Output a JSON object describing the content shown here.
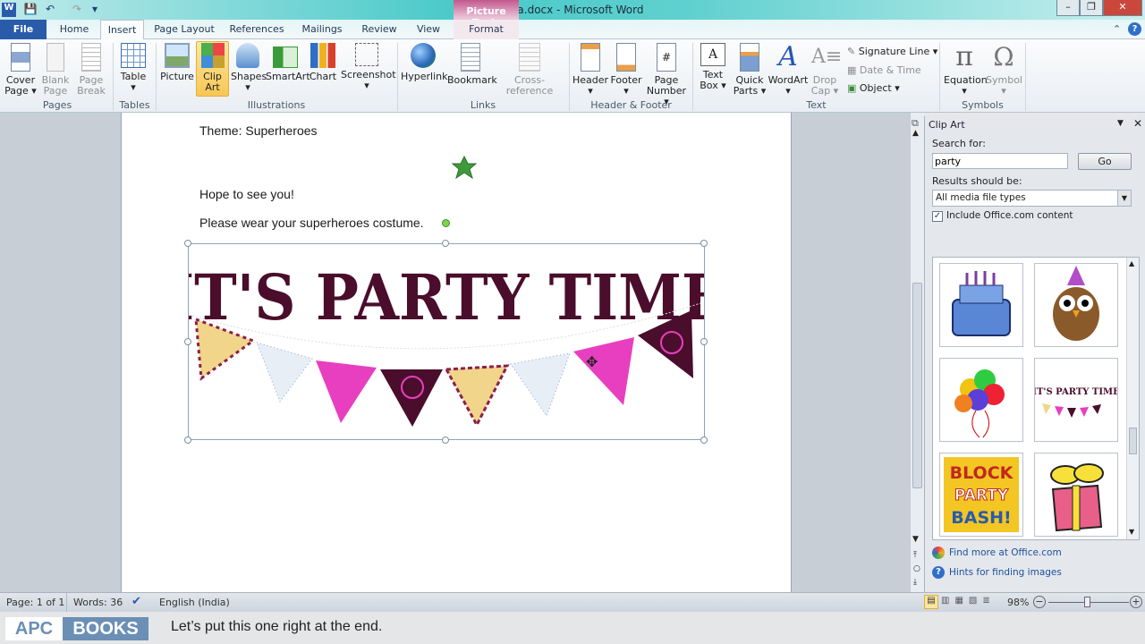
{
  "window": {
    "title": "Tina.docx - Microsoft Word",
    "context_tab_group": "Picture Tools"
  },
  "quick_access": [
    "word-app-icon",
    "save-icon",
    "undo-icon",
    "redo-icon",
    "customize-icon"
  ],
  "tabs": [
    {
      "label": "File"
    },
    {
      "label": "Home"
    },
    {
      "label": "Insert",
      "active": true
    },
    {
      "label": "Page Layout"
    },
    {
      "label": "References"
    },
    {
      "label": "Mailings"
    },
    {
      "label": "Review"
    },
    {
      "label": "View"
    },
    {
      "label": "Format"
    }
  ],
  "ribbon": {
    "groups": [
      "Pages",
      "Tables",
      "Illustrations",
      "Links",
      "Header & Footer",
      "Text",
      "Symbols"
    ],
    "buttons": [
      {
        "l1": "Cover",
        "l2": "Page ▾"
      },
      {
        "l1": "Blank",
        "l2": "Page"
      },
      {
        "l1": "Page",
        "l2": "Break"
      },
      {
        "l1": "Table",
        "l2": "▾"
      },
      {
        "l1": "Picture",
        "l2": ""
      },
      {
        "l1": "Clip",
        "l2": "Art"
      },
      {
        "l1": "Shapes",
        "l2": "▾"
      },
      {
        "l1": "SmartArt",
        "l2": ""
      },
      {
        "l1": "Chart",
        "l2": ""
      },
      {
        "l1": "Screenshot",
        "l2": "▾"
      },
      {
        "l1": "Hyperlink",
        "l2": ""
      },
      {
        "l1": "Bookmark",
        "l2": ""
      },
      {
        "l1": "Cross-reference",
        "l2": ""
      },
      {
        "l1": "Header",
        "l2": "▾"
      },
      {
        "l1": "Footer",
        "l2": "▾"
      },
      {
        "l1": "Page",
        "l2": "Number ▾"
      },
      {
        "l1": "Text",
        "l2": "Box ▾"
      },
      {
        "l1": "Quick",
        "l2": "Parts ▾"
      },
      {
        "l1": "WordArt",
        "l2": "▾"
      },
      {
        "l1": "Drop",
        "l2": "Cap ▾"
      },
      {
        "l1": "Equation",
        "l2": "▾"
      },
      {
        "l1": "Symbol",
        "l2": "▾"
      }
    ],
    "small_buttons": [
      "Signature Line ▾",
      "Date & Time",
      "Object ▾"
    ]
  },
  "document": {
    "lines": [
      "Theme: Superheroes",
      "Hope to see you!",
      "Please wear your superheroes costume."
    ],
    "banner_text": "IT'S PARTY TIME",
    "colors": {
      "banner_text": "#4a0d2c",
      "pink": "#e83fc0",
      "maroon": "#4a0d2c",
      "star": "#3f9a3a"
    }
  },
  "clip_art_pane": {
    "title": "Clip Art",
    "search_label": "Search for:",
    "search_value": "party",
    "go_label": "Go",
    "results_label": "Results should be:",
    "results_value": "All media file types",
    "include_label": "Include Office.com content",
    "include_checked": true,
    "thumb_text": {
      "party_time": "IT'S PARTY TIME",
      "block1": "BLOCK",
      "block2": "PARTY",
      "block3": "BASH!"
    },
    "links": [
      "Find more at Office.com",
      "Hints for finding images"
    ]
  },
  "status": {
    "page": "Page: 1 of 1",
    "words": "Words: 36",
    "language": "English (India)",
    "zoom": "98%",
    "zoom_level": 98
  },
  "caption": {
    "brand1": "APC",
    "brand2": "BOOKS",
    "text": "Let’s put this one right at the end."
  }
}
